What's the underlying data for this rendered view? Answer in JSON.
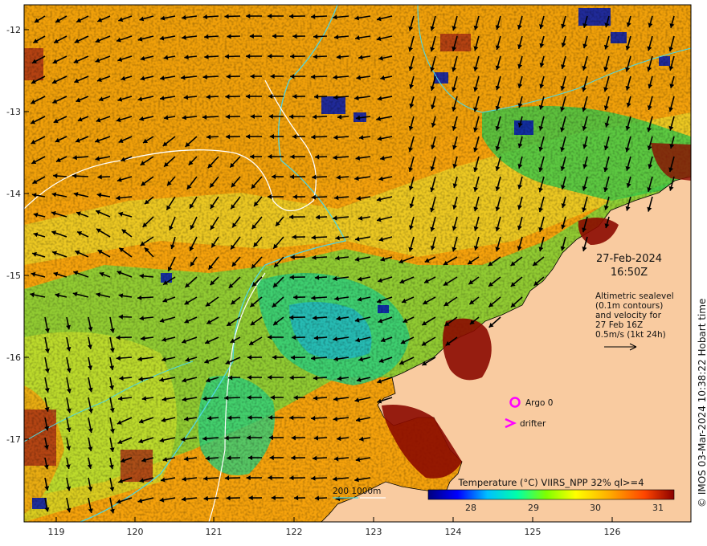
{
  "axes": {
    "lat_labels": [
      "-12",
      "-13",
      "-14",
      "-15",
      "-16",
      "-17"
    ],
    "lon_labels": [
      "119",
      "120",
      "121",
      "122",
      "123",
      "124",
      "125",
      "126"
    ]
  },
  "overlay": {
    "date": "27-Feb-2024",
    "time": "16:50Z",
    "altimetry_lines": [
      "Altimetric sealevel",
      "(0.1m contours)",
      "and velocity for",
      "27 Feb 16Z",
      "0.5m/s (1kt 24h)"
    ],
    "argo_label": "Argo 0",
    "drifter_label": "drifter",
    "depth_legend": "200  1000m"
  },
  "colorbar": {
    "title": "Temperature (°C) VIIRS_NPP 32% ql>=4",
    "ticks": [
      "28",
      "29",
      "30",
      "31"
    ],
    "stops": [
      "#00007f",
      "#0000ff",
      "#00bfff",
      "#00ffaa",
      "#7fff00",
      "#ffff00",
      "#ffaa00",
      "#ff4500",
      "#8b0000"
    ]
  },
  "credit": "© IMOS 03-Mar-2024 10:38:22 Hobart time",
  "colors": {
    "land": "#f9cba0",
    "argo": "#ff00ff",
    "contour_200m": "#4fd6e0",
    "contour_1000m": "#ffffff",
    "arrows": "#000000"
  }
}
